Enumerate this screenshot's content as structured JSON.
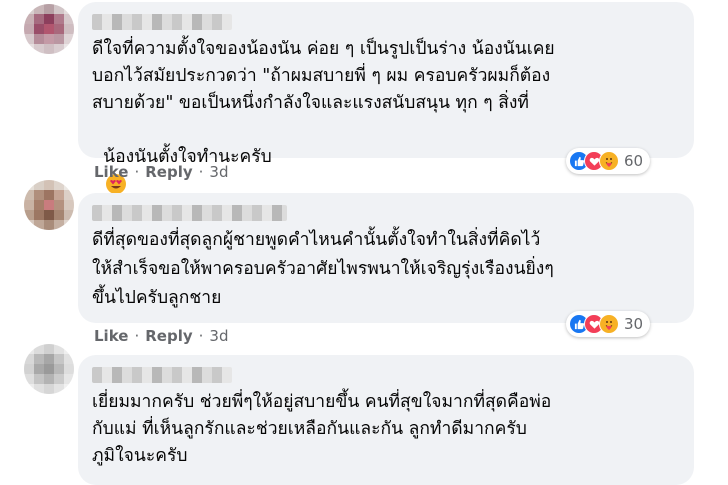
{
  "comments": [
    {
      "lines": [
        "ดีใจที่ความตั้งใจของน้องนัน ค่อย ๆ เป็นรูปเป็นร่าง น้องนันเคย",
        "บอกไว้สมัยประกวดว่า \"ถ้าผมสบายพี่ ๆ ผม ครอบครัวผมก็ต้อง",
        "สบายด้วย\" ขอเป็นหนึ่งกำลังใจและแรงสนับสนุน ทุก ๆ สิ่งที่",
        "น้องนันตั้งใจทำนะครับ"
      ],
      "emojis": [
        "heart-eyes-emoji",
        "heart-eyes-emoji"
      ],
      "like": "Like",
      "reply": "Reply",
      "time": "3d",
      "reactions": [
        "like-reaction-icon",
        "love-reaction-icon",
        "care-reaction-icon"
      ],
      "reaction_count": "60"
    },
    {
      "lines": [
        "ดีที่สุดของที่สุดลูกผู้ชายพูดคำไหนคำนั้นตั้งใจทำในสิ่งที่คิดไว้",
        "ให้สำเร็จขอให้พาครอบครัวอาศัยไพรพนาให้เจริญรุ่งเรืองนยิ่งๆ",
        "ขึ้นไปครับลูกชาย"
      ],
      "like": "Like",
      "reply": "Reply",
      "time": "3d",
      "reactions": [
        "like-reaction-icon",
        "love-reaction-icon",
        "care-reaction-icon"
      ],
      "reaction_count": "30"
    },
    {
      "lines": [
        "เยี่ยมมากครับ ช่วยพี่ๆให้อยู่สบายขึ้น คนที่สุขใจมากที่สุดคือพ่อ",
        "กับแม่ ที่เห็นลูกรักและช่วยเหลือกันและกัน ลูกทำดีมากครับ",
        "ภูมิใจนะครับ"
      ]
    }
  ],
  "colors": {
    "bubble": "#f0f2f5",
    "meta_text": "#65676b",
    "like_blue": "#1877f2",
    "love_red": "#f33e58",
    "care_yellow": "#f7b125"
  }
}
